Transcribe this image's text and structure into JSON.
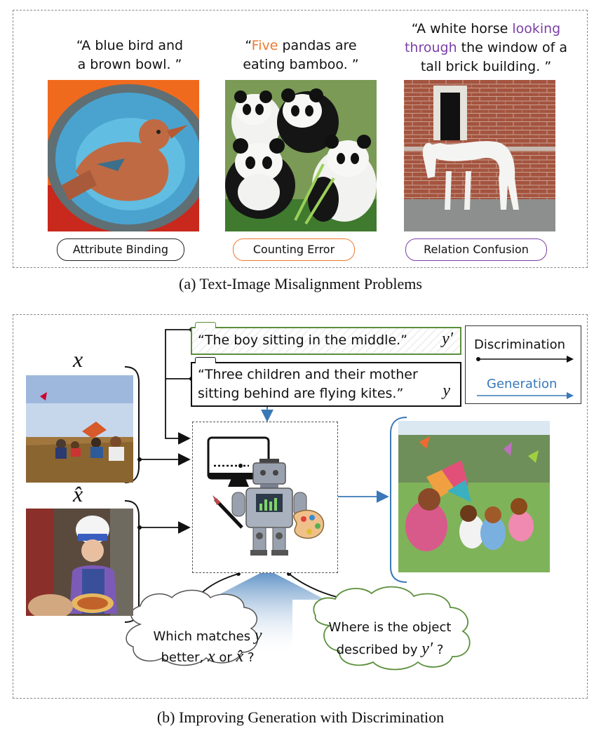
{
  "panel_a": {
    "examples": [
      {
        "quote_line1": "“A blue bird and",
        "quote_line2": "a brown bowl. ”",
        "label": "Attribute Binding",
        "color": "#222222"
      },
      {
        "quote_open": "“",
        "quote_highlight": "Five",
        "quote_rest": " pandas are",
        "quote_line2": "eating bamboo. ”",
        "label": "Counting Error",
        "color": "#ee7a2f"
      },
      {
        "quote_line1a": "“A white horse ",
        "quote_highlight1": "looking",
        "quote_highlight2": "through",
        "quote_line2b": " the window of a",
        "quote_line3": "tall brick building. ”",
        "label": "Relation Confusion",
        "color": "#7b3fa6"
      }
    ],
    "caption": "(a) Text-Image Misalignment Problems"
  },
  "panel_b": {
    "prompt_negative": "“The boy sitting in the middle.”",
    "prompt_negative_var": "y′",
    "prompt_positive_line1": "“Three children and their mother",
    "prompt_positive_line2": "sitting behind are flying kites.”",
    "prompt_positive_var": "y",
    "image_x_label": "x",
    "image_xhat_label": "x̂",
    "legend": {
      "discrimination": "Discrimination",
      "generation": "Generation"
    },
    "cloud_left": {
      "line1": "Which matches",
      "var_y": "y",
      "line2a": "better,",
      "var_x": "x",
      "or": "or",
      "var_xhat": "x̂",
      "q": "?"
    },
    "cloud_right": {
      "line1": "Where is the object",
      "line2": "described by",
      "var": "y′",
      "q": "?"
    },
    "caption": "(b) Improving Generation with Discrimination"
  },
  "colors": {
    "generation_blue": "#3a78b8",
    "green": "#5b8f3a",
    "orange": "#ee7a2f",
    "purple": "#7b3fa6"
  }
}
